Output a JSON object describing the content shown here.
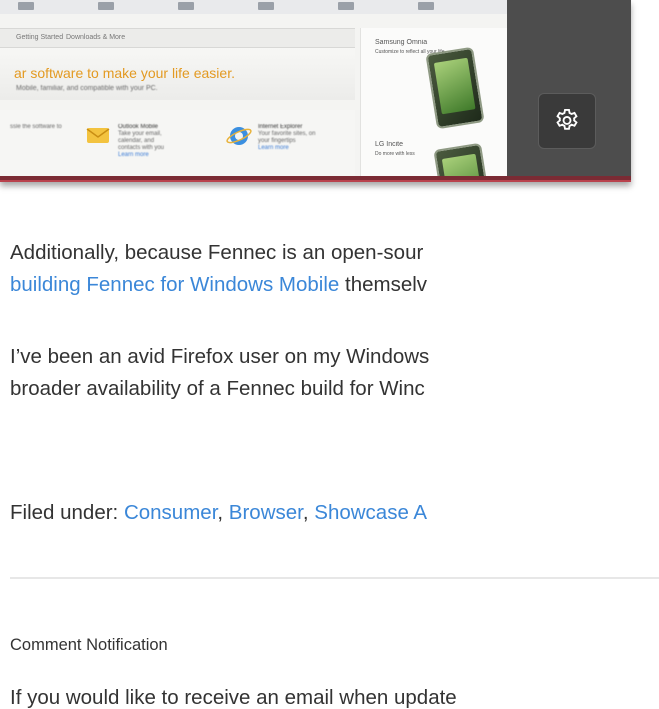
{
  "screenshot": {
    "nav_items": [
      "Getting Started",
      "Downloads & More"
    ],
    "tagline": "ar software to make your life easier.",
    "subline": "Mobile, familiar, and compatible with your PC.",
    "apps": [
      {
        "title": "Outlook Mobile",
        "desc": "Take your email, calendar, and contacts with you",
        "link": "Learn more"
      },
      {
        "title": "Internet Explorer",
        "desc": "Your favorite sites, on your fingertips",
        "link": "Learn more"
      }
    ],
    "left_app_text": "ssle the software to",
    "ads": [
      {
        "title": "Samsung Omnia",
        "desc": "Customize to reflect all your life"
      },
      {
        "title": "LG Incite",
        "desc": "Do more with less"
      }
    ],
    "colors": {
      "frame": "#7b2b34",
      "accent_orange": "#e39a22",
      "dark_panel": "#4d4d4d"
    },
    "settings_icon": "gear-icon"
  },
  "article": {
    "para1": {
      "line1": "Additionally, because Fennec is an open-sour",
      "link": "building Fennec for Windows Mobile",
      "line2_rest": " themselv"
    },
    "para2": {
      "line1": "I’ve been an avid Firefox user on my Windows",
      "line2": "broader availability of a Fennec build for Winc"
    },
    "filed": {
      "label": "Filed under: ",
      "categories": [
        "Consumer",
        "Browser",
        "Showcase A"
      ],
      "sep": ", "
    }
  },
  "comments": {
    "title": "Comment Notification",
    "intro": "If you would like to receive an email when update"
  },
  "colors": {
    "link": "#3b87d8",
    "text": "#333333",
    "divider": "#e7e7e7"
  }
}
